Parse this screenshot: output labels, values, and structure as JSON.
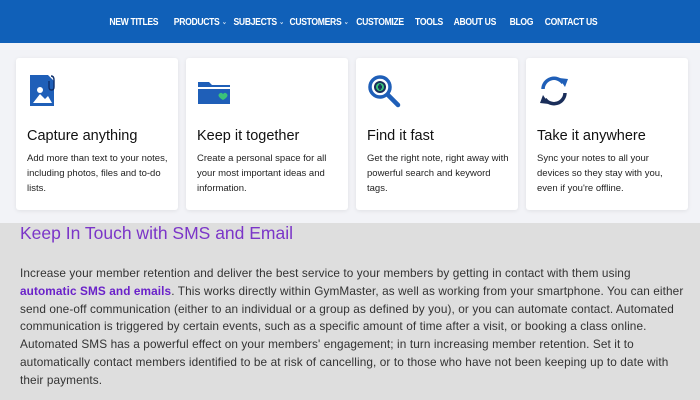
{
  "nav": {
    "items": [
      {
        "label": "New Titles",
        "dropdown": false
      },
      {
        "label": "Products",
        "dropdown": true
      },
      {
        "label": "Subjects",
        "dropdown": true
      },
      {
        "label": "Customers",
        "dropdown": true
      },
      {
        "label": "Customize",
        "dropdown": false
      },
      {
        "label": "Tools",
        "dropdown": false
      },
      {
        "label": "About Us",
        "dropdown": false
      },
      {
        "label": "Blog",
        "dropdown": false
      },
      {
        "label": "Contact Us",
        "dropdown": false
      }
    ],
    "caret": "⌄",
    "bg_color": "#1060b8"
  },
  "features": [
    {
      "icon": "document-image-icon",
      "title": "Capture anything",
      "desc": "Add more than text to your notes, including photos, files and to-do lists."
    },
    {
      "icon": "folder-heart-icon",
      "title": "Keep it together",
      "desc": "Create a personal space for all your most important ideas and information."
    },
    {
      "icon": "magnifier-icon",
      "title": "Find it fast",
      "desc": "Get the right note, right away with powerful search and keyword tags."
    },
    {
      "icon": "sync-icon",
      "title": "Take it anywhere",
      "desc": "Sync your notes to all your devices so they stay with you, even if you're offline."
    }
  ],
  "section": {
    "heading": "Keep In Touch with SMS and Email",
    "body_before": "Increase your member retention and deliver the best service to your members by getting in contact with them using ",
    "link_text": "automatic SMS and emails",
    "body_after": ". This works directly within GymMaster, as well as working from your smartphone. You can either send one-off communication (either to an individual or a group as defined by you), or you can automate contact. Automated communication is triggered by certain events, such as a specific amount of time after a visit, or booking a class online. Automated SMS has a powerful effect on your members' engagement; in turn increasing member retention. Set it to automatically contact members identified to be at risk of cancelling, or to those who have not been keeping up to date with their payments.",
    "heading_color": "#7b35c8",
    "link_color": "#6a22c9"
  }
}
